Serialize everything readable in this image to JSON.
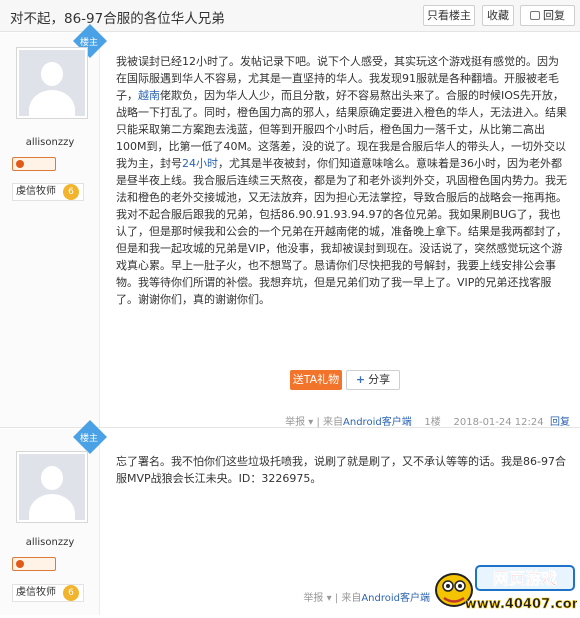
{
  "header": {
    "title": "对不起，86-97合服的各位华人兄弟",
    "only_author": "只看楼主",
    "favorite": "收藏",
    "reply": "回复"
  },
  "posts": [
    {
      "badge": "楼主",
      "username": "allisonzzy",
      "title_tag": "虔信牧师",
      "level": "6",
      "content": {
        "p1": "我被误封已经12小时了。发帖记录下吧。说下个人感受，其实玩这个游戏挺有感觉的。因为在国际服遇到华人不容易，尤其是一直坚持的华人。我发现91服就是各种翻墙。开服被老毛子，",
        "link1": "越南",
        "p2": "佬欺负，因为华人人少，而且分散，好不容易熬出头来了。合服的时候IOS先开放，战略一下打乱了。同时，橙色国力高的邪人，结果原确定要进入橙色的华人，无法进入。结果只能采取第二方案跑去浅蓝，但等到开服四个小时后，橙色国力一落千丈，从比第二高出100M到，比第一低了40M。这落差，没的说了。现在我是合服后华人的带头人，一切外交以我为主，封号",
        "link2": "24小时",
        "p3": "，尤其是半夜被封，你们知道意味啥么。意味着是36小时，因为老外都是昼半夜上线。我合服后连续三天熬夜，都是为了和老外谈判外交，巩固橙色国内势力。我无法和橙色的老外交接城池，又无法放弃，因为担心无法掌控，导致合服后的战略会一拖再拖。我对不起合服后跟我的兄弟，包括86.90.91.93.94.97的各位兄弟。我如果刷BUG了，我也认了，但是那时候我和公会的一个兄弟在开越南佬的城，准备晚上拿下。结果是我两都封了，但是和我一起攻城的兄弟是VIP，他没事，我却被误封到现在。没话说了，突然感觉玩这个游戏真心累。早上一肚子火，也不想骂了。恳请你们尽快把我的号解封，我要上线安排公会事物。我等待你们所谓的补偿。我想弃坑，但是兄弟们劝了我一早上了。VIP的兄弟还找客服了。谢谢你们，真的谢谢你们。"
      },
      "gift_button": "送TA礼物",
      "share_button": "分享",
      "meta": {
        "report": "举报",
        "source_prefix": "来自",
        "source": "Android客户端",
        "floor": "1楼",
        "time": "2018-01-24 12:24",
        "reply": "回复"
      }
    },
    {
      "badge": "楼主",
      "username": "allisonzzy",
      "title_tag": "虔信牧师",
      "level": "6",
      "content": "忘了署名。我不怕你们这些垃圾托喷我，说刷了就是刷了，又不承认等等的话。我是86-97合服MVP战狼会长江未央。ID：3226975。",
      "meta": {
        "report": "举报",
        "source_prefix": "来自",
        "source": "Android客户端"
      }
    }
  ],
  "watermark": {
    "title": "网页游戏",
    "url": "www.40407.com"
  }
}
